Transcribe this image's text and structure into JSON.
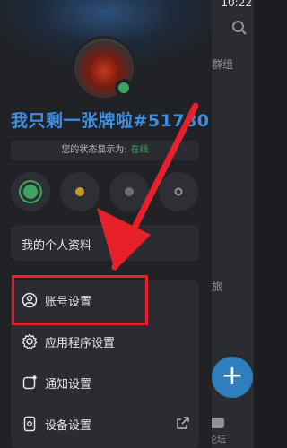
{
  "status_bar": {
    "time": "10:22"
  },
  "background_app": {
    "fragments": [
      "群组",
      "旅",
      "论坛"
    ],
    "fab_label": "+"
  },
  "profile": {
    "username": "我只剩一张牌啦#51780",
    "status_prefix": "您的状态显示为:",
    "status_value": "在线"
  },
  "status_options": [
    {
      "name": "online",
      "color": "#3ba55d"
    },
    {
      "name": "idle",
      "color": "#c59a2a"
    },
    {
      "name": "dnd",
      "color": "#6d6f73"
    },
    {
      "name": "invisible",
      "color": "#8e9297"
    }
  ],
  "menu": {
    "my_profile": "我的个人资料",
    "account_settings": "账号设置",
    "app_settings": "应用程序设置",
    "notification_settings": "通知设置",
    "device_settings": "设备设置"
  },
  "colors": {
    "accent": "#3f8de0",
    "online": "#3ba55d",
    "annotation": "#e8202a"
  }
}
